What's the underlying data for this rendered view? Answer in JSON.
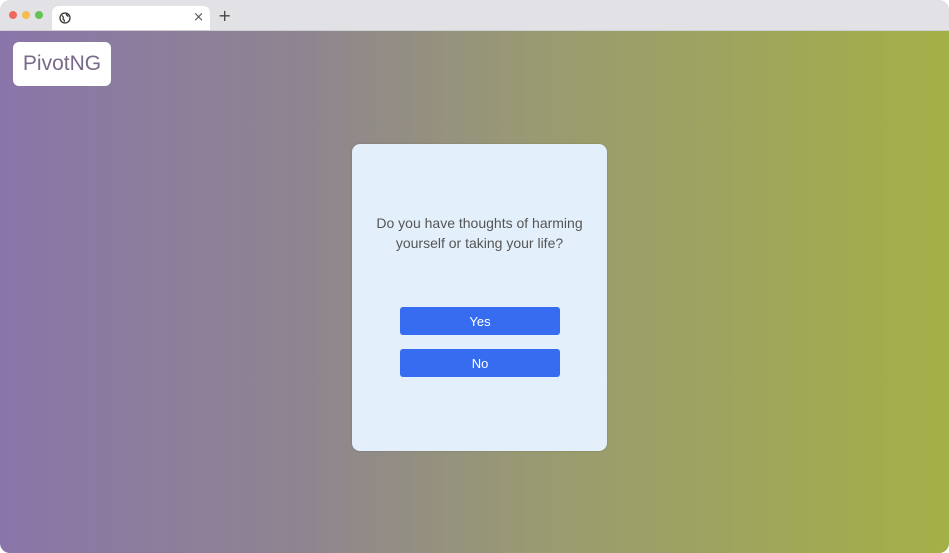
{
  "browser": {
    "tab_title": "",
    "tab_close": "×",
    "new_tab": "+"
  },
  "header": {
    "logo_text": "PivotNG"
  },
  "dialog": {
    "question": "Do you have thoughts of harming yourself or taking your life?",
    "yes_label": "Yes",
    "no_label": "No"
  },
  "colors": {
    "primary_button": "#356cf0",
    "card_background": "#e3effb",
    "gradient_start": "#8a75a9",
    "gradient_end": "#a3b047"
  }
}
